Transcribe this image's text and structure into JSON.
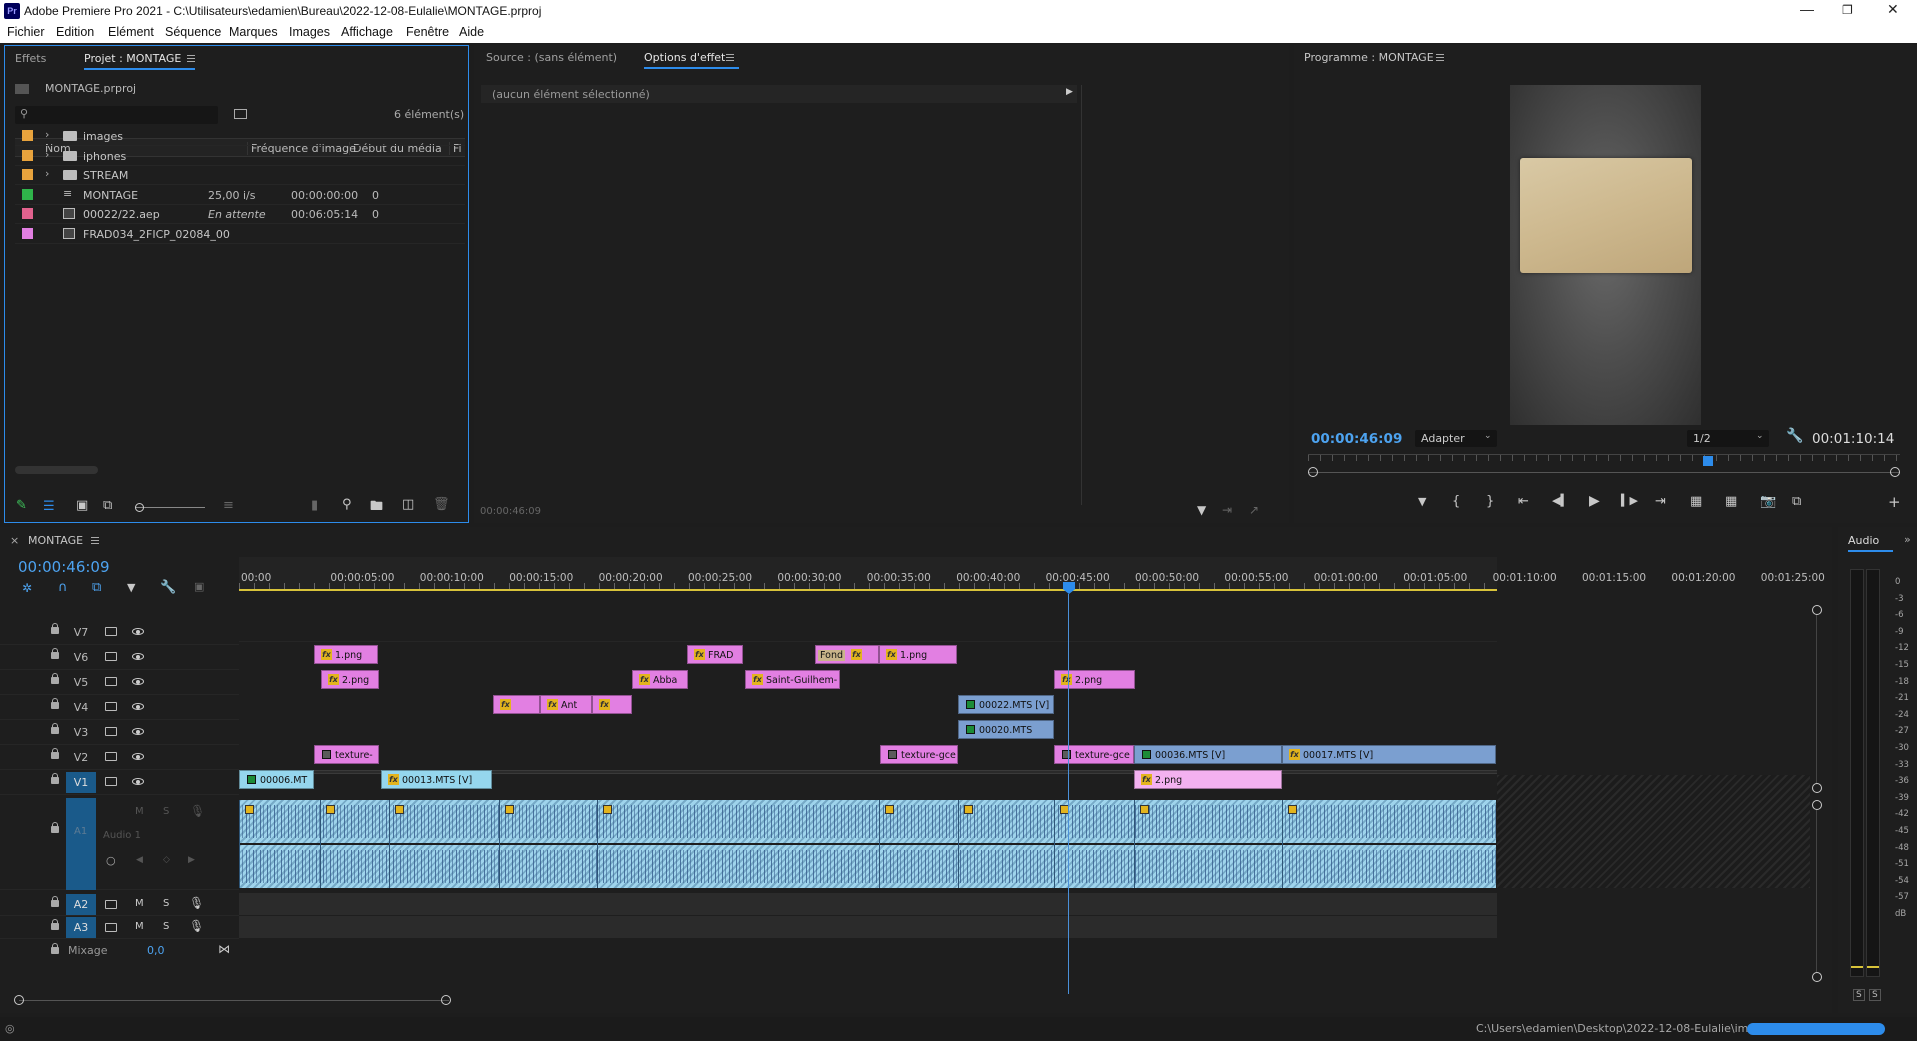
{
  "window": {
    "app_icon": "Pr",
    "title": "Adobe Premiere Pro 2021 - C:\\Utilisateurs\\edamien\\Bureau\\2022-12-08-Eulalie\\MONTAGE.prproj"
  },
  "menu": [
    "Fichier",
    "Edition",
    "Elément",
    "Séquence",
    "Marques",
    "Images",
    "Affichage",
    "Fenêtre",
    "Aide"
  ],
  "project_panel": {
    "tabs": [
      "Effets",
      "Projet : MONTAGE"
    ],
    "file": "MONTAGE.prproj",
    "search_placeholder": "",
    "item_count": "6 élément(s)",
    "columns": [
      "Nom",
      "Fréquence d'image",
      "Début du média",
      "Fi"
    ],
    "items": [
      {
        "name": "images",
        "type": "folder",
        "color": "#e8a33d",
        "fps": "",
        "start": "",
        "fi": ""
      },
      {
        "name": "iphones",
        "type": "folder",
        "color": "#e8a33d",
        "fps": "",
        "start": "",
        "fi": ""
      },
      {
        "name": "STREAM",
        "type": "folder",
        "color": "#e8a33d",
        "fps": "",
        "start": "",
        "fi": ""
      },
      {
        "name": "MONTAGE",
        "type": "sequence",
        "color": "#2fb44a",
        "fps": "25,00 i/s",
        "start": "00:00:00:00",
        "fi": "0"
      },
      {
        "name": "00022/22.aep",
        "type": "aep",
        "color": "#e2628e",
        "fps": "En attente",
        "start": "00:06:05:14",
        "fi": "0"
      },
      {
        "name": "FRAD034_2FICP_02084_00",
        "type": "image",
        "color": "#e27fe2",
        "fps": "",
        "start": "",
        "fi": ""
      }
    ]
  },
  "source_panel": {
    "tabs": [
      "Source : (sans élément)",
      "Options d'effet"
    ],
    "no_selection": "(aucun élément sélectionné)",
    "timecode": "00:00:46:09"
  },
  "program_panel": {
    "tab": "Programme : MONTAGE",
    "timecode": "00:00:46:09",
    "fit": "Adapter",
    "resolution": "1/2",
    "duration": "00:01:10:14"
  },
  "timeline": {
    "close": "×",
    "name": "MONTAGE",
    "timecode": "00:00:46:09",
    "ruler": [
      "00:00",
      "00:00:05:00",
      "00:00:10:00",
      "00:00:15:00",
      "00:00:20:00",
      "00:00:25:00",
      "00:00:30:00",
      "00:00:35:00",
      "00:00:40:00",
      "00:00:45:00",
      "00:00:50:00",
      "00:00:55:00",
      "00:01:00:00",
      "00:01:05:00",
      "00:01:10:00",
      "00:01:15:00",
      "00:01:20:00",
      "00:01:25:00"
    ],
    "video_tracks": [
      "V7",
      "V6",
      "V5",
      "V4",
      "V3",
      "V2",
      "V1"
    ],
    "audio_tracks": [
      "A1",
      "A2",
      "A3"
    ],
    "audio_track_label": "Audio 1",
    "m": "M",
    "s": "S",
    "mix_label": "Mixage",
    "mix_value": "0,0",
    "clip_labels": {
      "v6_a": "1.png",
      "v6_b": "FRAD",
      "v6_c": "Fond",
      "v6_d": "1.png",
      "v5_a": "2.png",
      "v5_b": "Abba",
      "v5_c": "Saint-Guilhem-",
      "v5_d": "2.png",
      "v4_b": "Ant",
      "v4_d": "00022.MTS [V]",
      "v3_a": "00020.MTS",
      "v2_a": "texture-",
      "v2_b": "texture-gce",
      "v2_c": "texture-gce",
      "v2_d": "00036.MTS [V]",
      "v2_e": "00017.MTS [V]",
      "v1_a": "00006.MT",
      "v1_b": "00013.MTS [V]",
      "v1_c": "2.png"
    }
  },
  "audio_meter": {
    "tab": "Audio",
    "labels": [
      "0",
      "-3",
      "-6",
      "-9",
      "-12",
      "-15",
      "-18",
      "-21",
      "-24",
      "-27",
      "-30",
      "-33",
      "-36",
      "-39",
      "-42",
      "-45",
      "-48",
      "-51",
      "-54",
      "-57",
      "dB"
    ],
    "solo": [
      "S",
      "S"
    ]
  },
  "status_bar": {
    "path": "C:\\Users\\edamien\\Desktop\\2022-12-08-Eulalie\\im...",
    "progress": 1.0
  },
  "colors": {
    "accent": "#2d8ceb",
    "playhead": "#4a90d9",
    "video_clip_pink": "#e27fe2",
    "video_clip_blue": "#7b9fd0",
    "audio_clip": "#9fd4ec"
  }
}
